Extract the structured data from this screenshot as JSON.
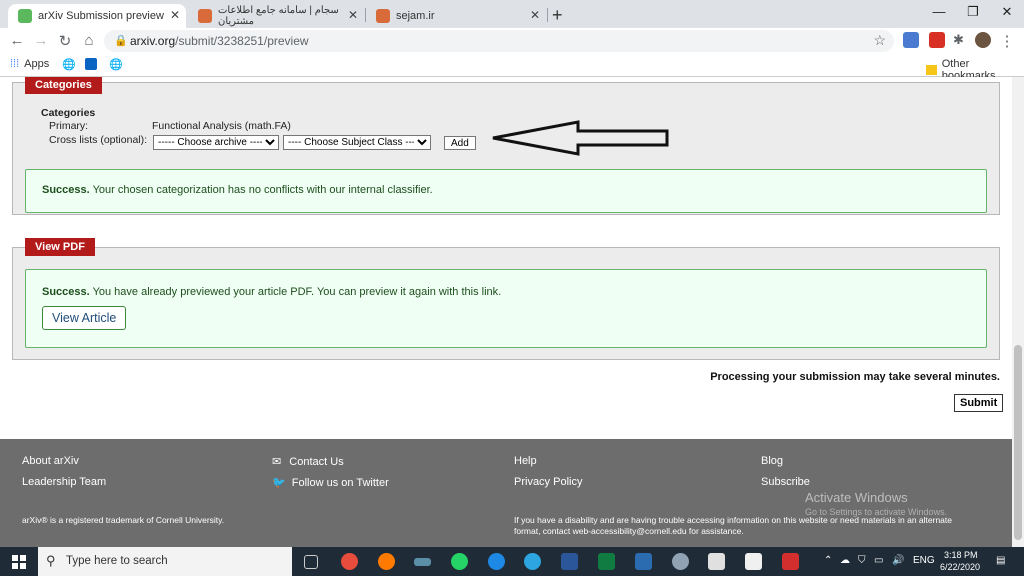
{
  "browser": {
    "tabs": [
      {
        "title": "arXiv Submission preview",
        "active": true
      },
      {
        "title": "سجام | سامانه جامع اطلاعات مشتریان",
        "active": false
      },
      {
        "title": "sejam.ir",
        "active": false
      }
    ],
    "url_host": "arxiv.org",
    "url_path": "/submit/3238251/preview",
    "bookmarks": {
      "apps": "Apps",
      "other": "Other bookmarks"
    }
  },
  "categories": {
    "legend": "Categories",
    "heading": "Categories",
    "primary_label": "Primary:",
    "primary_value": "Functional Analysis (math.FA)",
    "crosslist_label": "Cross lists (optional):",
    "archive_select": "----- Choose archive -----",
    "subject_select": "---- Choose Subject Class ----",
    "add_button": "Add",
    "success_strong": "Success.",
    "success_text": "Your chosen categorization has no conflicts with our internal classifier."
  },
  "view_pdf": {
    "legend": "View PDF",
    "success_strong": "Success.",
    "success_text": "You have already previewed your article PDF. You can preview it again with this link.",
    "button": "View Article"
  },
  "processing_note": "Processing your submission may take several minutes.",
  "submit_button": "Submit",
  "footer": {
    "about": "About arXiv",
    "leadership": "Leadership Team",
    "contact": "Contact Us",
    "twitter": "Follow us on Twitter",
    "help": "Help",
    "privacy": "Privacy Policy",
    "blog": "Blog",
    "subscribe": "Subscribe",
    "trademark": "arXiv® is a registered trademark of Cornell University.",
    "accessibility_line1": "If you have a disability and are having trouble accessing information on this website or need materials in an alternate",
    "accessibility_line2": "format, contact web-accessibility@cornell.edu for assistance.",
    "watermark_title": "Activate Windows",
    "watermark_sub": "Go to Settings to activate Windows."
  },
  "taskbar": {
    "search_placeholder": "Type here to search",
    "lang": "ENG",
    "time": "3:18 PM",
    "date": "6/22/2020"
  },
  "colors": {
    "legend_red": "#b31b1b",
    "success_bg": "#f0fff4",
    "success_border": "#67b46b",
    "footer_bg": "#6d6d6d"
  }
}
